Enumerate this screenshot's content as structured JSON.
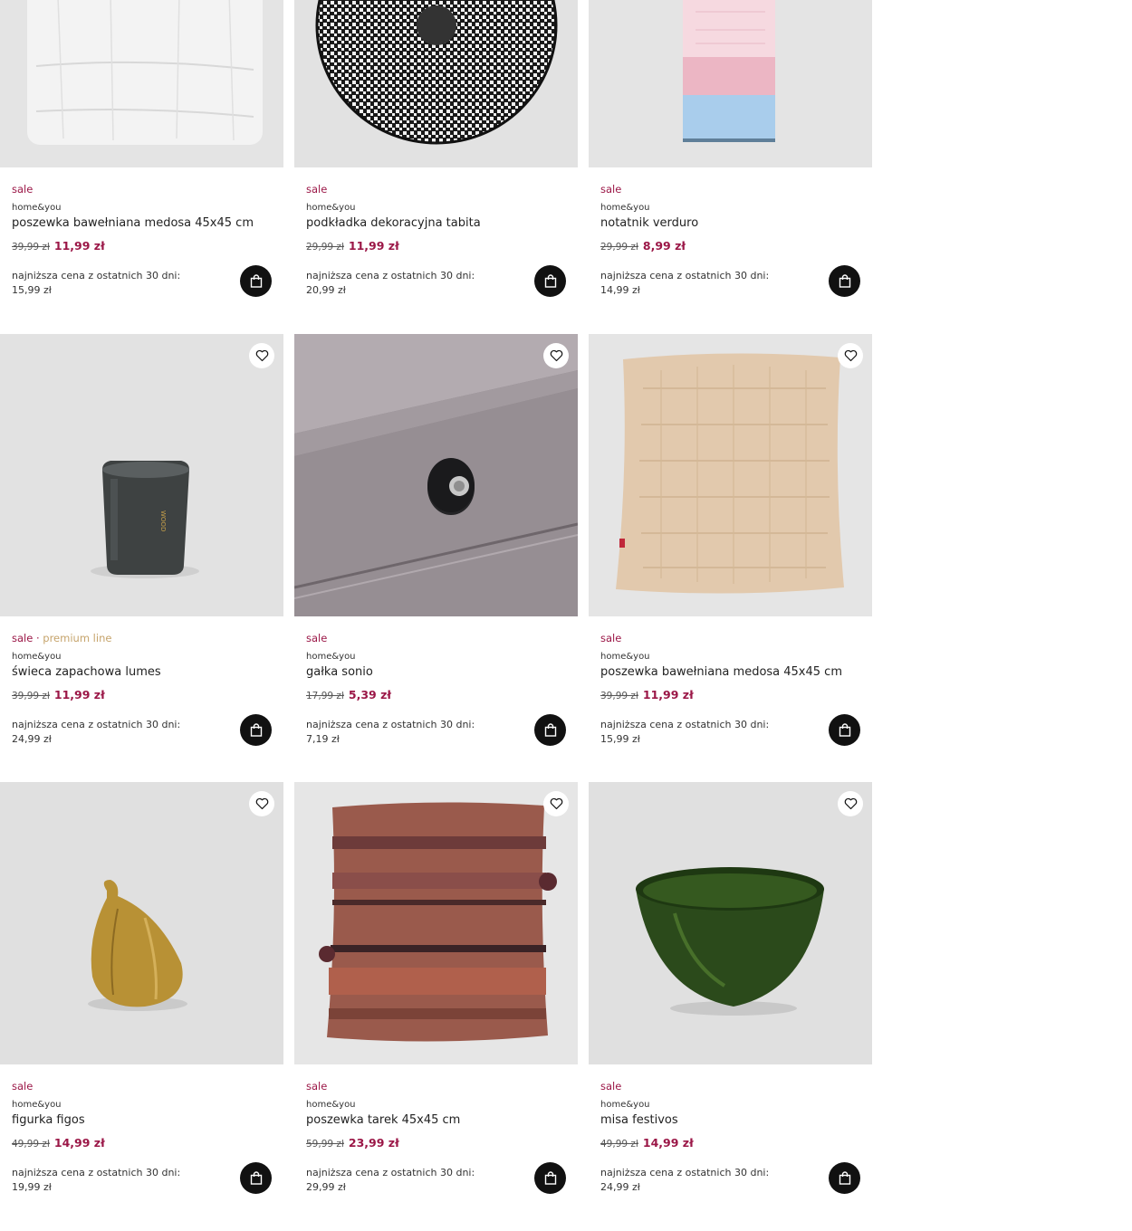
{
  "lowest_label": "najniższa cena z ostatnich 30 dni:",
  "products": [
    {
      "tag": "sale",
      "premium": "",
      "brand": "home&you",
      "name": "poszewka bawełniana medosa 45x45 cm",
      "old_price": "39,99 zł",
      "new_price": "11,99 zł",
      "lowest_price": "15,99 zł",
      "image_icon": "white-cushion-image",
      "has_fav": false
    },
    {
      "tag": "sale",
      "premium": "",
      "brand": "home&you",
      "name": "podkładka dekoracyjna tabita",
      "old_price": "29,99 zł",
      "new_price": "11,99 zł",
      "lowest_price": "20,99 zł",
      "image_icon": "round-placemat-image",
      "has_fav": false
    },
    {
      "tag": "sale",
      "premium": "",
      "brand": "home&you",
      "name": "notatnik verduro",
      "old_price": "29,99 zł",
      "new_price": "8,99 zł",
      "lowest_price": "14,99 zł",
      "image_icon": "notepad-image",
      "has_fav": false
    },
    {
      "tag": "sale",
      "premium": "premium line",
      "brand": "home&you",
      "name": "świeca zapachowa lumes",
      "old_price": "39,99 zł",
      "new_price": "11,99 zł",
      "lowest_price": "24,99 zł",
      "image_icon": "candle-image",
      "has_fav": true
    },
    {
      "tag": "sale",
      "premium": "",
      "brand": "home&you",
      "name": "gałka sonio",
      "old_price": "17,99 zł",
      "new_price": "5,39 zł",
      "lowest_price": "7,19 zł",
      "image_icon": "drawer-knob-image",
      "has_fav": true
    },
    {
      "tag": "sale",
      "premium": "",
      "brand": "home&you",
      "name": "poszewka bawełniana medosa 45x45 cm",
      "old_price": "39,99 zł",
      "new_price": "11,99 zł",
      "lowest_price": "15,99 zł",
      "image_icon": "beige-cushion-image",
      "has_fav": true
    },
    {
      "tag": "sale",
      "premium": "",
      "brand": "home&you",
      "name": "figurka figos",
      "old_price": "49,99 zł",
      "new_price": "14,99 zł",
      "lowest_price": "19,99 zł",
      "image_icon": "golden-fig-image",
      "has_fav": true
    },
    {
      "tag": "sale",
      "premium": "",
      "brand": "home&you",
      "name": "poszewka tarek 45x45 cm",
      "old_price": "59,99 zł",
      "new_price": "23,99 zł",
      "lowest_price": "29,99 zł",
      "image_icon": "striped-cushion-image",
      "has_fav": true
    },
    {
      "tag": "sale",
      "premium": "",
      "brand": "home&you",
      "name": "misa festivos",
      "old_price": "49,99 zł",
      "new_price": "14,99 zł",
      "lowest_price": "24,99 zł",
      "image_icon": "green-bowl-image",
      "has_fav": true
    }
  ],
  "colors": {
    "sale": "#9b1747",
    "premium": "#c6a46c",
    "cart_button": "#111111"
  }
}
